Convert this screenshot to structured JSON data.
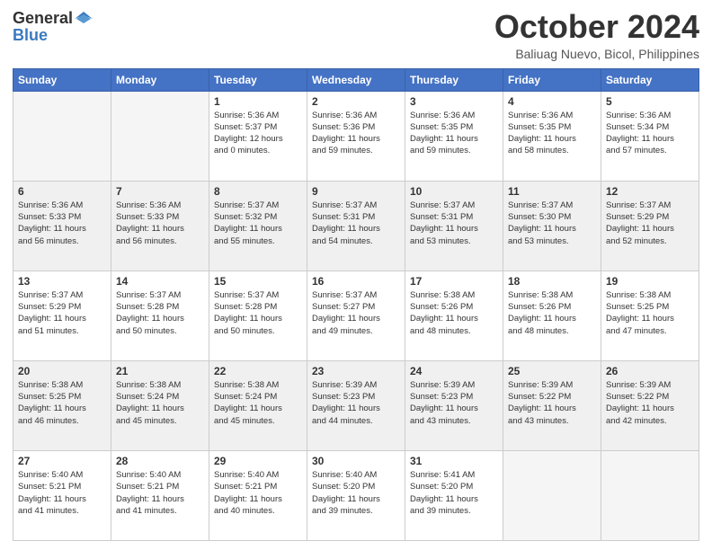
{
  "header": {
    "logo_general": "General",
    "logo_blue": "Blue",
    "month_title": "October 2024",
    "location": "Baliuag Nuevo, Bicol, Philippines"
  },
  "weekdays": [
    "Sunday",
    "Monday",
    "Tuesday",
    "Wednesday",
    "Thursday",
    "Friday",
    "Saturday"
  ],
  "weeks": [
    [
      {
        "day": "",
        "info": ""
      },
      {
        "day": "",
        "info": ""
      },
      {
        "day": "1",
        "info": "Sunrise: 5:36 AM\nSunset: 5:37 PM\nDaylight: 12 hours\nand 0 minutes."
      },
      {
        "day": "2",
        "info": "Sunrise: 5:36 AM\nSunset: 5:36 PM\nDaylight: 11 hours\nand 59 minutes."
      },
      {
        "day": "3",
        "info": "Sunrise: 5:36 AM\nSunset: 5:35 PM\nDaylight: 11 hours\nand 59 minutes."
      },
      {
        "day": "4",
        "info": "Sunrise: 5:36 AM\nSunset: 5:35 PM\nDaylight: 11 hours\nand 58 minutes."
      },
      {
        "day": "5",
        "info": "Sunrise: 5:36 AM\nSunset: 5:34 PM\nDaylight: 11 hours\nand 57 minutes."
      }
    ],
    [
      {
        "day": "6",
        "info": "Sunrise: 5:36 AM\nSunset: 5:33 PM\nDaylight: 11 hours\nand 56 minutes."
      },
      {
        "day": "7",
        "info": "Sunrise: 5:36 AM\nSunset: 5:33 PM\nDaylight: 11 hours\nand 56 minutes."
      },
      {
        "day": "8",
        "info": "Sunrise: 5:37 AM\nSunset: 5:32 PM\nDaylight: 11 hours\nand 55 minutes."
      },
      {
        "day": "9",
        "info": "Sunrise: 5:37 AM\nSunset: 5:31 PM\nDaylight: 11 hours\nand 54 minutes."
      },
      {
        "day": "10",
        "info": "Sunrise: 5:37 AM\nSunset: 5:31 PM\nDaylight: 11 hours\nand 53 minutes."
      },
      {
        "day": "11",
        "info": "Sunrise: 5:37 AM\nSunset: 5:30 PM\nDaylight: 11 hours\nand 53 minutes."
      },
      {
        "day": "12",
        "info": "Sunrise: 5:37 AM\nSunset: 5:29 PM\nDaylight: 11 hours\nand 52 minutes."
      }
    ],
    [
      {
        "day": "13",
        "info": "Sunrise: 5:37 AM\nSunset: 5:29 PM\nDaylight: 11 hours\nand 51 minutes."
      },
      {
        "day": "14",
        "info": "Sunrise: 5:37 AM\nSunset: 5:28 PM\nDaylight: 11 hours\nand 50 minutes."
      },
      {
        "day": "15",
        "info": "Sunrise: 5:37 AM\nSunset: 5:28 PM\nDaylight: 11 hours\nand 50 minutes."
      },
      {
        "day": "16",
        "info": "Sunrise: 5:37 AM\nSunset: 5:27 PM\nDaylight: 11 hours\nand 49 minutes."
      },
      {
        "day": "17",
        "info": "Sunrise: 5:38 AM\nSunset: 5:26 PM\nDaylight: 11 hours\nand 48 minutes."
      },
      {
        "day": "18",
        "info": "Sunrise: 5:38 AM\nSunset: 5:26 PM\nDaylight: 11 hours\nand 48 minutes."
      },
      {
        "day": "19",
        "info": "Sunrise: 5:38 AM\nSunset: 5:25 PM\nDaylight: 11 hours\nand 47 minutes."
      }
    ],
    [
      {
        "day": "20",
        "info": "Sunrise: 5:38 AM\nSunset: 5:25 PM\nDaylight: 11 hours\nand 46 minutes."
      },
      {
        "day": "21",
        "info": "Sunrise: 5:38 AM\nSunset: 5:24 PM\nDaylight: 11 hours\nand 45 minutes."
      },
      {
        "day": "22",
        "info": "Sunrise: 5:38 AM\nSunset: 5:24 PM\nDaylight: 11 hours\nand 45 minutes."
      },
      {
        "day": "23",
        "info": "Sunrise: 5:39 AM\nSunset: 5:23 PM\nDaylight: 11 hours\nand 44 minutes."
      },
      {
        "day": "24",
        "info": "Sunrise: 5:39 AM\nSunset: 5:23 PM\nDaylight: 11 hours\nand 43 minutes."
      },
      {
        "day": "25",
        "info": "Sunrise: 5:39 AM\nSunset: 5:22 PM\nDaylight: 11 hours\nand 43 minutes."
      },
      {
        "day": "26",
        "info": "Sunrise: 5:39 AM\nSunset: 5:22 PM\nDaylight: 11 hours\nand 42 minutes."
      }
    ],
    [
      {
        "day": "27",
        "info": "Sunrise: 5:40 AM\nSunset: 5:21 PM\nDaylight: 11 hours\nand 41 minutes."
      },
      {
        "day": "28",
        "info": "Sunrise: 5:40 AM\nSunset: 5:21 PM\nDaylight: 11 hours\nand 41 minutes."
      },
      {
        "day": "29",
        "info": "Sunrise: 5:40 AM\nSunset: 5:21 PM\nDaylight: 11 hours\nand 40 minutes."
      },
      {
        "day": "30",
        "info": "Sunrise: 5:40 AM\nSunset: 5:20 PM\nDaylight: 11 hours\nand 39 minutes."
      },
      {
        "day": "31",
        "info": "Sunrise: 5:41 AM\nSunset: 5:20 PM\nDaylight: 11 hours\nand 39 minutes."
      },
      {
        "day": "",
        "info": ""
      },
      {
        "day": "",
        "info": ""
      }
    ]
  ]
}
